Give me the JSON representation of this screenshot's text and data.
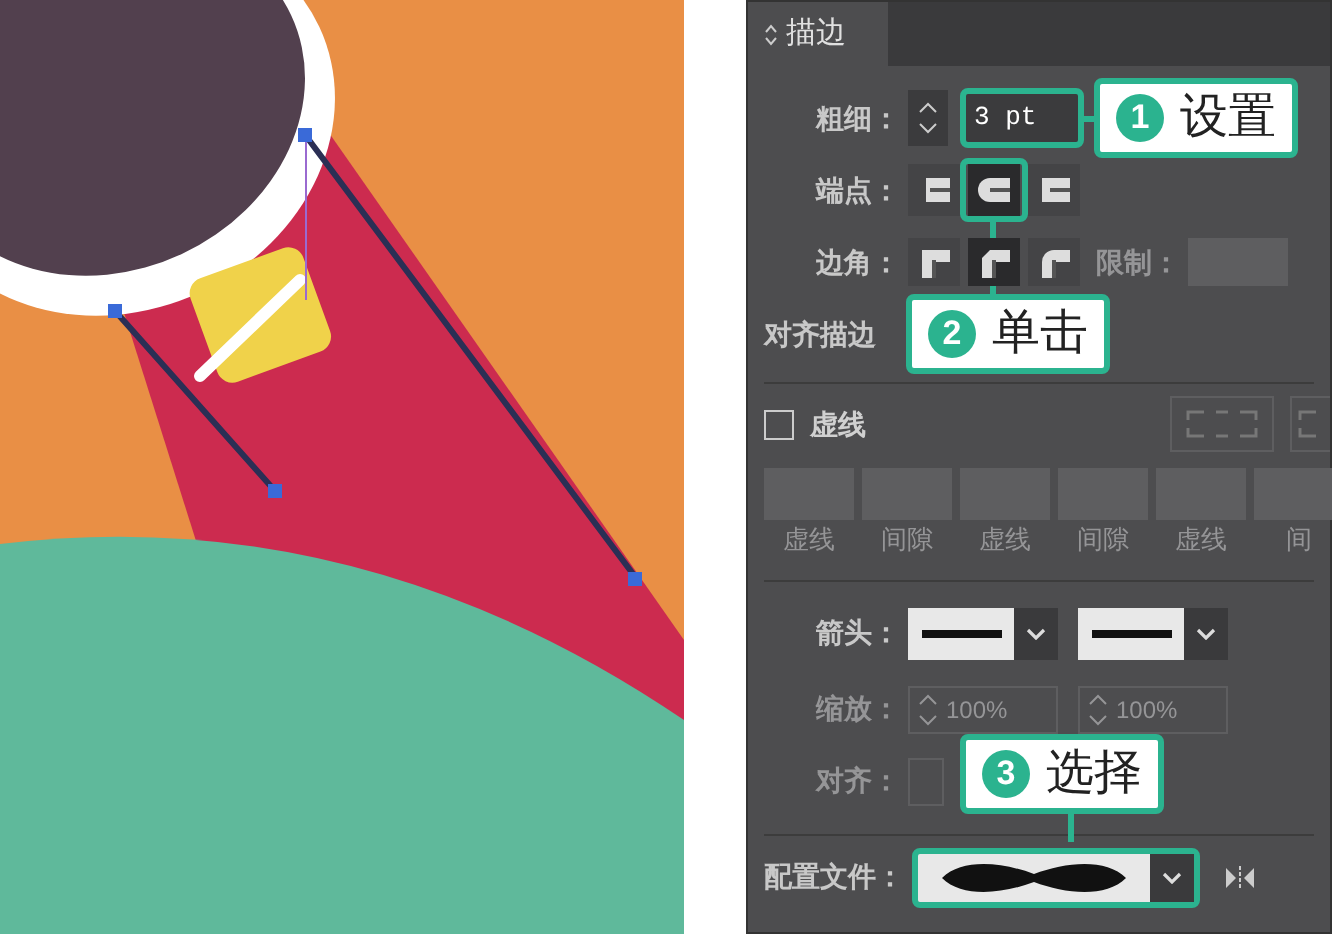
{
  "panel": {
    "title": "描边",
    "weight": {
      "label": "粗细：",
      "value": "3 pt"
    },
    "caps": {
      "label": "端点：",
      "options": [
        {
          "selected": false
        },
        {
          "selected": true
        },
        {
          "selected": false
        }
      ]
    },
    "corners": {
      "label": "边角：",
      "limit_label": "限制：",
      "options": [
        {
          "selected": false
        },
        {
          "selected": true
        },
        {
          "selected": false
        }
      ]
    },
    "align_label": "对齐描边",
    "dashed": {
      "label": "虚线",
      "checked": false
    },
    "dash_labels": [
      "虚线",
      "间隙",
      "虚线",
      "间隙",
      "虚线",
      "间"
    ],
    "arrowheads": {
      "label": "箭头："
    },
    "scale": {
      "label": "缩放：",
      "values": [
        "100%",
        "100%"
      ]
    },
    "align": {
      "label": "对齐："
    },
    "profile": {
      "label": "配置文件："
    }
  },
  "callouts": [
    {
      "number": "1",
      "text": "设置"
    },
    {
      "number": "2",
      "text": "单击"
    },
    {
      "number": "3",
      "text": "选择"
    }
  ]
}
